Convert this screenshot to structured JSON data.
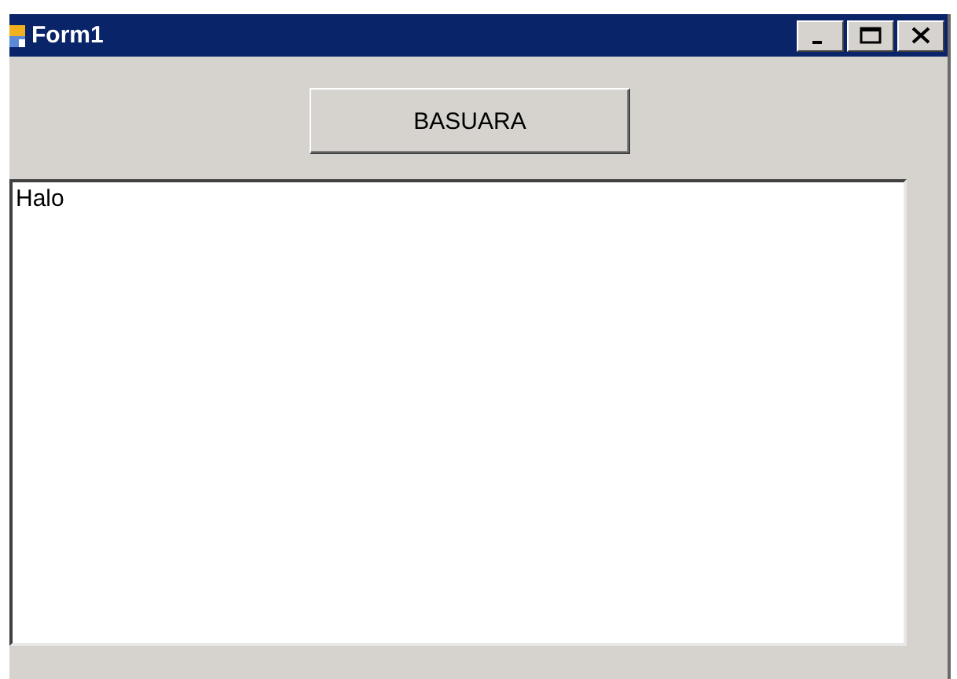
{
  "window": {
    "title": "Form1"
  },
  "button": {
    "label": "BASUARA"
  },
  "textbox": {
    "value": "Halo"
  }
}
